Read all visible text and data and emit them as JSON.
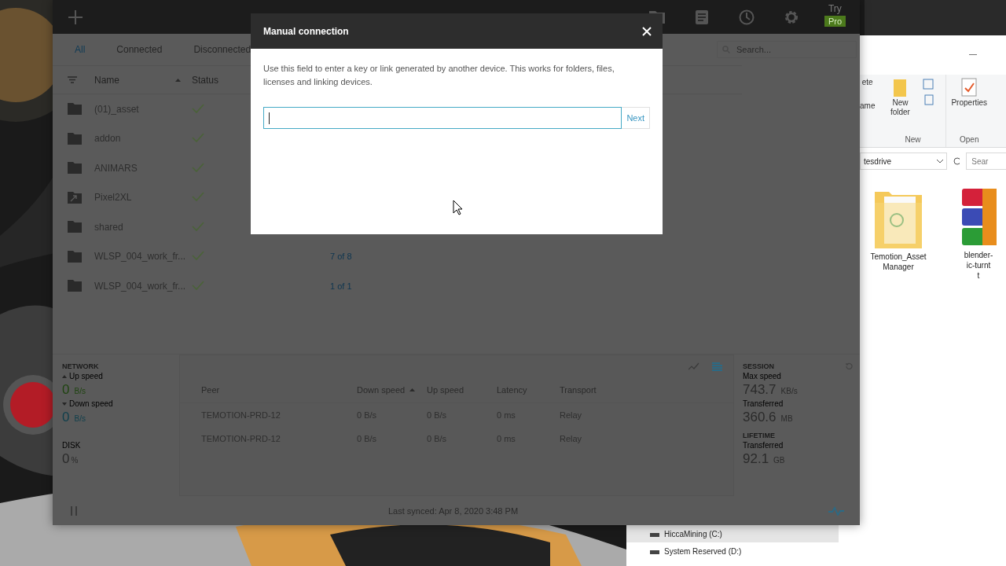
{
  "sync_app": {
    "toolbar": {
      "try_label": "Try",
      "pro_badge": "Pro"
    },
    "filter_tabs": [
      {
        "label": "All",
        "selected": true
      },
      {
        "label": "Connected",
        "selected": false
      },
      {
        "label": "Disconnected",
        "selected": false
      }
    ],
    "search": {
      "placeholder": "Search..."
    },
    "columns": [
      {
        "label": "Name",
        "sorted": true
      },
      {
        "label": "Status",
        "sorted": false
      }
    ],
    "folders": [
      {
        "name": "(01)_asset",
        "kind": "folder",
        "synced": true
      },
      {
        "name": "addon",
        "kind": "folder",
        "synced": true
      },
      {
        "name": "ANIMARS",
        "kind": "folder",
        "synced": true
      },
      {
        "name": "Pixel2XL",
        "kind": "shortcut",
        "synced": true
      },
      {
        "name": "shared",
        "kind": "folder",
        "synced": true
      },
      {
        "name": "WLSP_004_work_fr...",
        "kind": "folder",
        "synced": true,
        "column_3": "7 of 8"
      },
      {
        "name": "WLSP_004_work_fr...",
        "kind": "folder",
        "synced": true,
        "column_3": "1 of 1"
      }
    ],
    "network": {
      "title": "NETWORK",
      "up_label": "Up speed",
      "up_value": "0",
      "up_unit": "B/s",
      "down_label": "Down speed",
      "down_value": "0",
      "down_unit": "B/s",
      "disk_label": "DISK",
      "disk_value": "0",
      "disk_unit": "%"
    },
    "peers": {
      "columns": [
        {
          "label": "Peer",
          "sorted": false
        },
        {
          "label": "Down speed",
          "sorted": true
        },
        {
          "label": "Up speed",
          "sorted": false
        },
        {
          "label": "Latency",
          "sorted": false
        },
        {
          "label": "Transport",
          "sorted": false
        }
      ],
      "rows": [
        [
          "TEMOTION-PRD-12",
          "0 B/s",
          "0 B/s",
          "0 ms",
          "Relay"
        ],
        [
          "TEMOTION-PRD-12",
          "0 B/s",
          "0 B/s",
          "0 ms",
          "Relay"
        ]
      ]
    },
    "session": {
      "title": "SESSION",
      "max_label": "Max speed",
      "max_value": "743.7",
      "max_unit": "KB/s",
      "transferred_label": "Transferred",
      "transferred_value": "360.6",
      "transferred_unit": "MB",
      "lifetime_title": "LIFETIME",
      "lifetime_label": "Transferred",
      "lifetime_value": "92.1",
      "lifetime_unit": "GB"
    },
    "footer": {
      "last_synced": "Last synced: Apr 8, 2020 3:48 PM"
    }
  },
  "dialog": {
    "title": "Manual connection",
    "text": "Use this field to enter a key or link generated by another device. This works for folders, files, licenses and linking devices.",
    "button": "Next"
  },
  "explorer": {
    "ribbon": {
      "delete_fragment": "ete",
      "rename_fragment": "ame",
      "new_folder": "New folder",
      "new_group": "New",
      "properties": "Properties",
      "open_group": "Open"
    },
    "address": "tesdrive",
    "search_placeholder": "Sear",
    "files": [
      {
        "label_lines": [
          "Temotion_Asset",
          "Manager"
        ],
        "kind": "folder"
      },
      {
        "label_lines": [
          "blender-",
          "ic-turnt",
          "t"
        ],
        "kind": "archive"
      }
    ],
    "drives": [
      {
        "label": "HiccaMining (C:)",
        "selected": true
      },
      {
        "label": "System Reserved (D:)",
        "selected": false
      }
    ]
  }
}
